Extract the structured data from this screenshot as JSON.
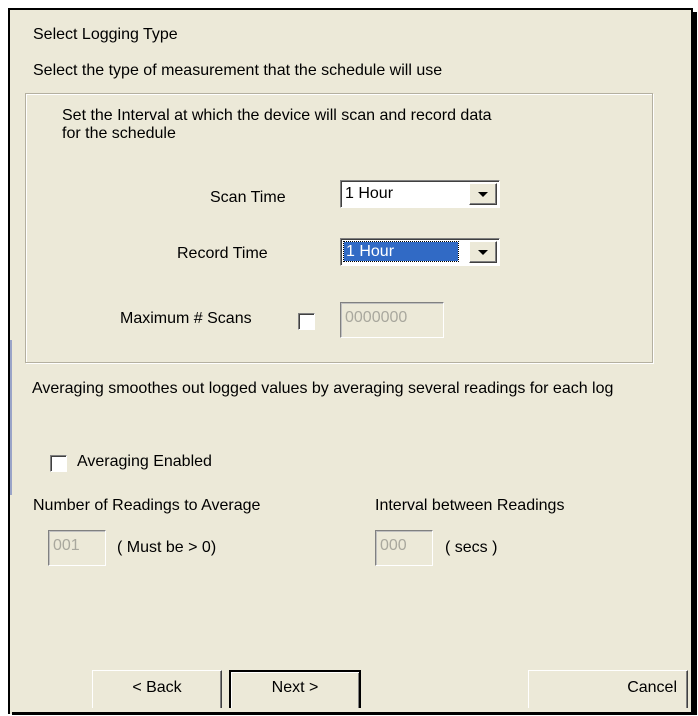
{
  "header": {
    "title": "Select Logging Type",
    "subtitle": "Select the type of measurement that the schedule will use"
  },
  "interval_group": {
    "description": "Set the Interval at which the device will scan and record data for the schedule",
    "scan_time": {
      "label": "Scan Time",
      "value": "1 Hour"
    },
    "record_time": {
      "label": "Record Time",
      "value": "1 Hour"
    },
    "max_scans": {
      "label": "Maximum # Scans",
      "checked": false,
      "value": "0000000"
    }
  },
  "averaging": {
    "description": "Averaging smoothes out logged values by averaging several readings for each log",
    "enabled_label": "Averaging Enabled",
    "enabled": false,
    "num_readings": {
      "label": "Number of Readings to Average",
      "value": "001",
      "hint": "( Must be > 0)"
    },
    "interval": {
      "label": "Interval between Readings",
      "value": "000",
      "hint": "( secs )"
    }
  },
  "buttons": {
    "back": "< Back",
    "next": "Next >",
    "cancel": "Cancel"
  }
}
